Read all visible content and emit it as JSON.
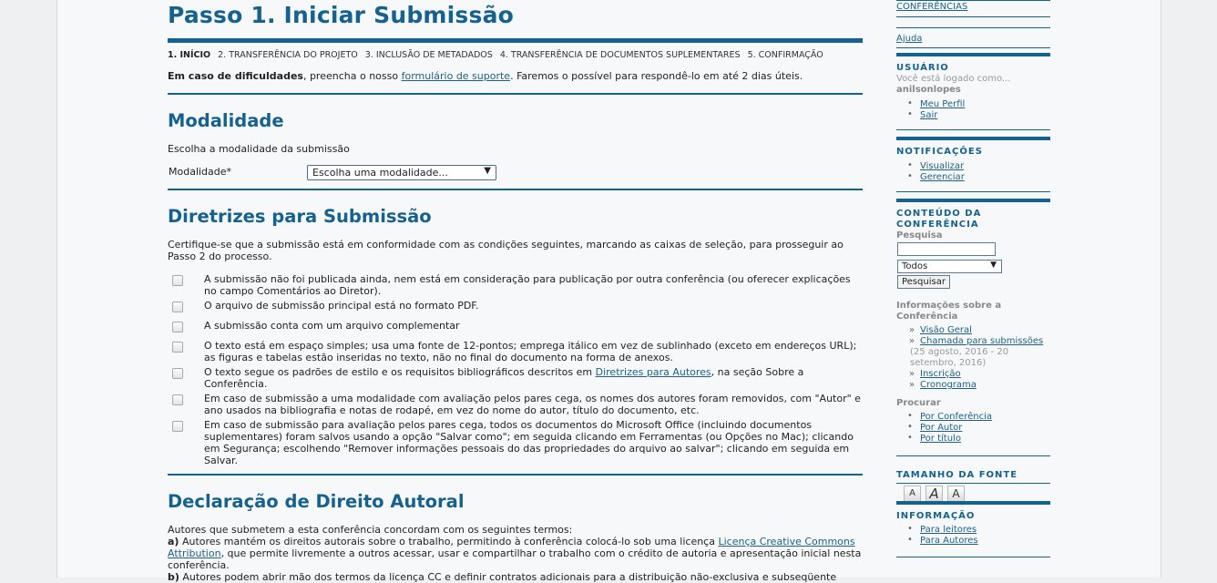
{
  "main": {
    "page_title": "Passo 1. Iniciar Submissão",
    "steps": [
      "1. INÍCIO",
      "2. TRANSFERÊNCIA DO PROJETO",
      "3. INCLUSÃO DE METADADOS",
      "4. TRANSFERÊNCIA DE DOCUMENTOS SUPLEMENTARES",
      "5. CONFIRMAÇÃO"
    ],
    "help": {
      "bold": "Em caso de dificuldades",
      "before_link": ", preencha o nosso ",
      "link": "formulário de suporte",
      "after_link": ". Faremos o possível para respondê-lo em até 2 dias úteis."
    },
    "modalidade": {
      "heading": "Modalidade",
      "intro": "Escolha a modalidade da submissão",
      "field_label": "Modalidade*",
      "select_value": "Escolha uma modalidade..."
    },
    "diretrizes": {
      "heading": "Diretrizes para Submissão",
      "intro": "Certifique-se que a submissão está em conformidade com as condições seguintes, marcando as caixas de seleção, para prosseguir ao Passo 2 do processo.",
      "items": [
        "A submissão não foi publicada ainda, nem está em consideração para publicação por outra conferência (ou oferecer explicações no campo Comentários ao Diretor).",
        "O arquivo de submissão principal está no formato PDF.",
        "A submissão conta com um arquivo complementar",
        "O texto está em espaço simples; usa uma fonte de 12-pontos; emprega itálico em vez de sublinhado (exceto em endereços URL); as figuras e tabelas estão inseridas no texto, não no final do documento na forma de anexos.",
        "Em caso de submissão a uma modalidade com avaliação pelos pares cega, os nomes dos autores foram removidos, com \"Autor\" e ano usados na bibliografia e notas de rodapé, em vez do nome do autor, título do documento, etc.",
        "Em caso de submissão para avaliação pelos pares cega, todos os documentos do Microsoft Office (incluindo documentos suplementares) foram salvos usando a opção \"Salvar como\"; em seguida clicando em Ferramentas (ou Opções no Mac); clicando em Segurança; escolhendo \"Remover informações pessoais do das propriedades do arquivo ao salvar\"; clicando em seguida em Salvar."
      ],
      "item_style": {
        "before": "O texto segue os padrões de estilo e os requisitos bibliográficos descritos em ",
        "link": "Diretrizes para Autores",
        "after": ", na seção Sobre a Conferência."
      }
    },
    "direito": {
      "heading": "Declaração de Direito Autoral",
      "intro": "Autores que submetem a esta conferência concordam com os seguintes termos:",
      "a_label": "a)",
      "a_before": " Autores mantém os direitos autorais sobre o trabalho, permitindo à conferência colocá-lo sob uma licença ",
      "a_link": "Licença Creative Commons Attribution",
      "a_after": ", que permite livremente a outros acessar, usar e compartilhar o trabalho com o crédito de autoria e apresentação inicial nesta conferência.",
      "b_label": "b)",
      "b_text": " Autores podem abrir mão dos termos da licença CC e definir contratos adicionais para a distribuição não-exclusiva e subseqüente"
    }
  },
  "sidebar": {
    "top_link": "CONFERÊNCIAS",
    "help_link": "Ajuda",
    "user": {
      "title": "USUÁRIO",
      "logged_as": "Você está logado como...",
      "username": "anilsonlopes",
      "links": [
        "Meu Perfil",
        "Sair"
      ]
    },
    "notifications": {
      "title": "NOTIFICAÇÕES",
      "links": [
        "Visualizar",
        "Gerenciar"
      ]
    },
    "content": {
      "title_line1": "CONTEÚDO DA",
      "title_line2": "CONFERÊNCIA",
      "search_label": "Pesquisa",
      "search_value": "",
      "scope_value": "Todos",
      "search_button": "Pesquisar",
      "info_heading_line1": "Informações sobre a",
      "info_heading_line2": "Conferência",
      "info_links": [
        "Visão Geral",
        "Chamada para submissões"
      ],
      "call_dates_line1": "(25 agosto, 2016 - 20",
      "call_dates_line2": "setembro, 2016)",
      "info_links2": [
        "Inscrição",
        "Cronograma"
      ],
      "browse_heading": "Procurar",
      "browse_links": [
        "Por Conferência",
        "Por Autor",
        "Por título"
      ]
    },
    "font_size": {
      "title": "TAMANHO DA FONTE",
      "buttons": [
        "A",
        "A",
        "A"
      ]
    },
    "information": {
      "title": "INFORMAÇÃO",
      "links": [
        "Para leitores",
        "Para Autores"
      ]
    }
  }
}
